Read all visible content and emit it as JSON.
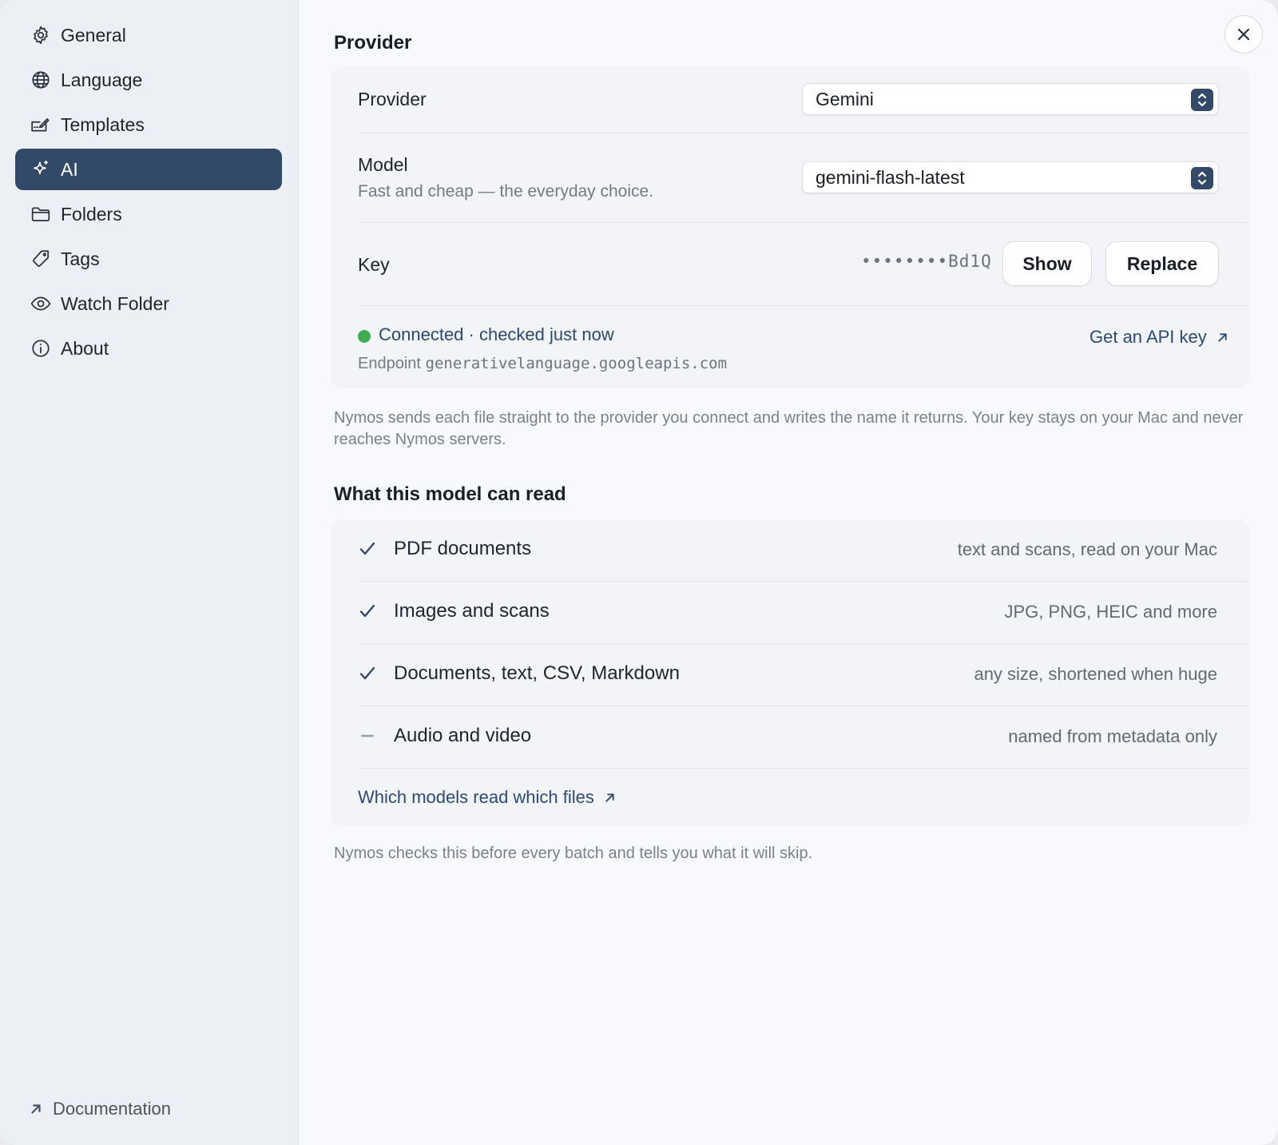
{
  "sidebar": {
    "items": [
      {
        "label": "General",
        "icon": "gear-icon"
      },
      {
        "label": "Language",
        "icon": "globe-icon"
      },
      {
        "label": "Templates",
        "icon": "templates-icon"
      },
      {
        "label": "AI",
        "icon": "sparkle-icon",
        "active": true
      },
      {
        "label": "Folders",
        "icon": "folder-icon"
      },
      {
        "label": "Tags",
        "icon": "tag-icon"
      },
      {
        "label": "Watch Folder",
        "icon": "eye-icon"
      },
      {
        "label": "About",
        "icon": "info-icon"
      }
    ],
    "documentation_label": "Documentation"
  },
  "provider_section": {
    "title": "Provider",
    "provider_label": "Provider",
    "provider_value": "Gemini",
    "model_label": "Model",
    "model_description": "Fast and cheap — the everyday choice.",
    "model_value": "gemini-flash-latest",
    "key_label": "Key",
    "key_masked": "••••••••Bd1Q",
    "show_button": "Show",
    "replace_button": "Replace",
    "status_text": "Connected · checked just now",
    "status_color": "#3fae52",
    "endpoint_label": "Endpoint",
    "endpoint_value": "generativelanguage.googleapis.com",
    "api_key_link": "Get an API key"
  },
  "provider_note": "Nymos sends each file straight to the provider you connect and writes the name it returns. Your key stays on your Mac and never reaches Nymos servers.",
  "capabilities_section": {
    "title": "What this model can read",
    "items": [
      {
        "label": "PDF documents",
        "detail": "text and scans, read on your Mac",
        "supported": true
      },
      {
        "label": "Images and scans",
        "detail": "JPG, PNG, HEIC and more",
        "supported": true
      },
      {
        "label": "Documents, text, CSV, Markdown",
        "detail": "any size, shortened when huge",
        "supported": true
      },
      {
        "label": "Audio and video",
        "detail": "named from metadata only",
        "supported": false
      }
    ],
    "link": "Which models read which files"
  },
  "capabilities_note": "Nymos checks this before every batch and tells you what it will skip.",
  "colors": {
    "accent": "#33496a",
    "link": "#2b4a78",
    "status_ok": "#3fae52"
  }
}
